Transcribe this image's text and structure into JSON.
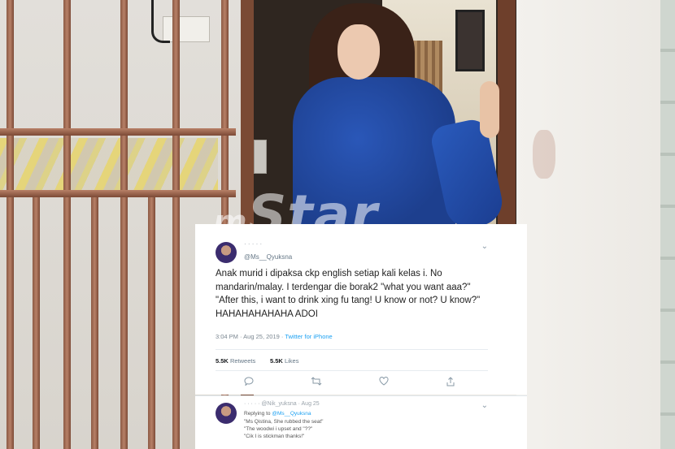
{
  "watermark": {
    "brand_prefix": "m",
    "brand_name": "Star"
  },
  "tweet": {
    "author_name": "· · · · ·",
    "author_handle": "@Ms__Qyuksna",
    "more_icon": "chevron-down-icon",
    "text": "Anak murid i dipaksa ckp english setiap kali kelas i. No mandarin/malay. I terdengar die borak2 \"what you want aaa?\" \"After this, i want to drink xing fu tang! U know or not? U know?\" HAHAHAHAHAHA ADOI",
    "time": "3:04 PM · Aug 25, 2019 ·",
    "client": "Twitter for iPhone",
    "retweets_count": "5.5K",
    "retweets_label": "Retweets",
    "likes_count": "5.5K",
    "likes_label": "Likes",
    "actions": [
      {
        "name": "reply-icon",
        "glyph": "💬"
      },
      {
        "name": "retweet-icon",
        "glyph": "⇄"
      },
      {
        "name": "like-icon",
        "glyph": "♡"
      },
      {
        "name": "share-icon",
        "glyph": "⇪"
      }
    ]
  },
  "reply": {
    "header": "· · · · ·  @Nik_yuksna · Aug 25",
    "replying_prefix": "Replying to",
    "replying_handle": "@Ms__Qyuksna",
    "lines": [
      "\"Ms Qistina, She rubbed the seat\"",
      "\"The woodwi i upset and \"??\"",
      "\"Cik I is stickman thanks!\""
    ]
  }
}
